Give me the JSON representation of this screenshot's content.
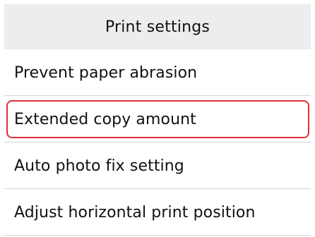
{
  "header": {
    "title": "Print settings"
  },
  "menu": {
    "items": [
      {
        "label": "Prevent paper abrasion",
        "selected": false
      },
      {
        "label": "Extended copy amount",
        "selected": true
      },
      {
        "label": "Auto photo fix setting",
        "selected": false
      },
      {
        "label": "Adjust horizontal print position",
        "selected": false
      }
    ]
  },
  "colors": {
    "title_background": "#ecedee",
    "divider": "#cfd2d5",
    "selection_border": "#e0303a",
    "text": "#111111"
  }
}
